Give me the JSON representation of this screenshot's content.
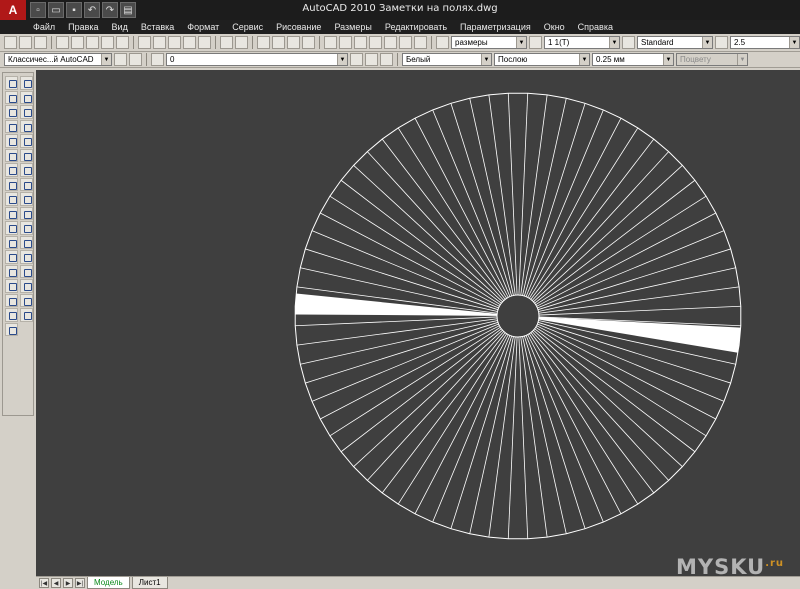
{
  "window": {
    "title": "AutoCAD 2010    Заметки на полях.dwg",
    "app_logo": "A"
  },
  "menu": [
    "Файл",
    "Правка",
    "Вид",
    "Вставка",
    "Формат",
    "Сервис",
    "Рисование",
    "Размеры",
    "Редактировать",
    "Параметризация",
    "Окно",
    "Справка"
  ],
  "toolbar_top": {
    "dim_style": "размеры",
    "scale": "1  1(Т)",
    "text_style": "Standard",
    "text_height": "2.5"
  },
  "toolbar_layers": {
    "workspace": "Классичес...й AutoCAD",
    "layer": "0",
    "color": "Белый",
    "linetype": "Послою",
    "lineweight": "0.25 мм",
    "plot_style": "Поцвету"
  },
  "drawing": {
    "background": "#3f3f3f",
    "line_color": "#ffffff",
    "spoke_count": 72,
    "filled_wedges": [
      {
        "start_deg": 180.4,
        "end_deg": 185.8
      },
      {
        "start_deg": 3.0,
        "end_deg": 9.5
      }
    ]
  },
  "layout_tabs": {
    "model": "Модель",
    "sheet1": "Лист1"
  },
  "watermark": {
    "text": "MYSKU",
    "suffix": ".ru"
  },
  "icons": {
    "app_menu": "autocad-logo-icon",
    "new": "new-file-icon",
    "open": "open-file-icon",
    "save": "save-icon",
    "undo": "undo-icon",
    "redo": "redo-icon",
    "print": "print-icon"
  }
}
